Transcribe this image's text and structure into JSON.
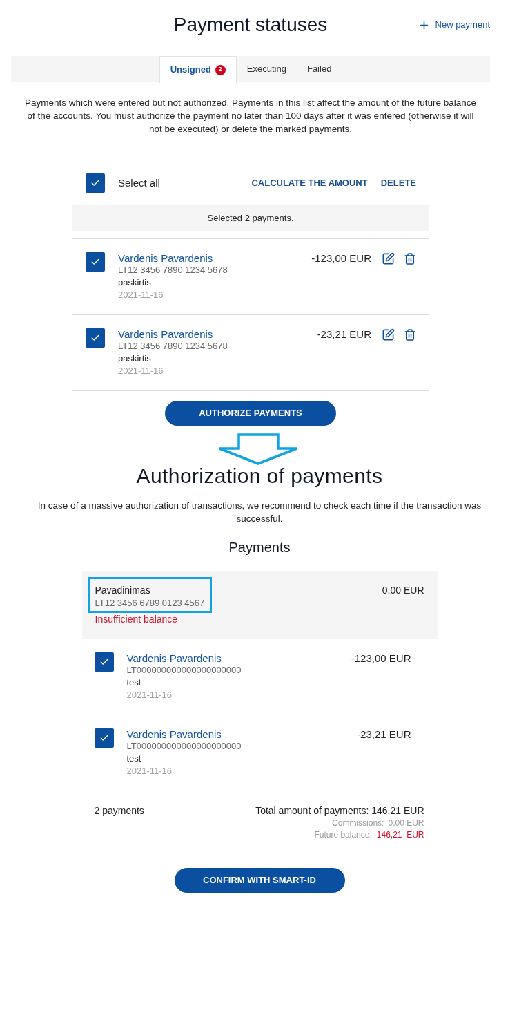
{
  "header": {
    "title": "Payment statuses",
    "new_payment": "New payment"
  },
  "tabs": [
    {
      "label": "Unsigned",
      "selected": true,
      "badge": "2"
    },
    {
      "label": "Executing",
      "selected": false
    },
    {
      "label": "Failed",
      "selected": false
    }
  ],
  "description": "Payments which were entered but not authorized. Payments in this list affect the amount of the future balance of the accounts. You must authorize the payment no later than 100 days after it was entered (otherwise it will not be executed) or delete the marked payments.",
  "unsigned": {
    "select_all": {
      "label": "Select all",
      "checked": true
    },
    "actions": [
      {
        "label": "CALCULATE THE AMOUNT"
      },
      {
        "label": "DELETE"
      }
    ],
    "selection_note": "Selected 2 payments.",
    "payments": [
      {
        "checked": true,
        "name": "Vardenis Pavardenis",
        "account": "LT12 3456 7890 1234 5678",
        "purpose": "paskirtis",
        "date": "2021-11-16",
        "amount": "-123,00 EUR"
      },
      {
        "checked": true,
        "name": "Vardenis Pavardenis",
        "account": "LT12 3456 7890 1234 5678",
        "purpose": "paskirtis",
        "date": "2021-11-16",
        "amount": "-23,21 EUR"
      }
    ],
    "authorize_button": "AUTHORIZE PAYMENTS"
  },
  "authorization": {
    "title": "Authorization of payments",
    "notice": "In case of a massive authorization of transactions, we recommend to check each time if the transaction was successful.",
    "payments_heading": "Payments",
    "account": {
      "name": "Pavadinimas",
      "iban": "LT12 3456 6789 0123 4567",
      "highlighted": true,
      "status": "Insufficient balance",
      "balance": "0,00 EUR"
    },
    "payments": [
      {
        "checked": true,
        "name": "Vardenis Pavardenis",
        "account": "LT000000000000000000000",
        "purpose": "test",
        "date": "2021-11-16",
        "amount": "-123,00 EUR"
      },
      {
        "checked": true,
        "name": "Vardenis Pavardenis",
        "account": "LT000000000000000000000",
        "purpose": "test",
        "date": "2021-11-16",
        "amount": "-23,21 EUR"
      }
    ],
    "summary": {
      "count": "2 payments",
      "total": "Total amount of payments: 146,21 EUR",
      "commissions_label": "Commissions:",
      "commissions": "0,00 EUR",
      "future_balance_label": "Future balance:",
      "future_balance": "-146,21  EUR"
    },
    "confirm_button": "CONFIRM WITH SMART-ID"
  }
}
